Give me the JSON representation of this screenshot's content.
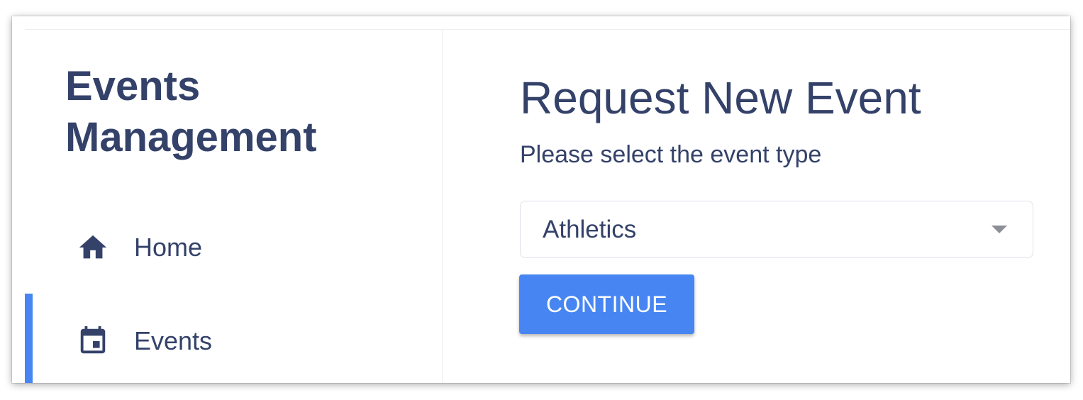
{
  "sidebar": {
    "app_title": "Events Management",
    "items": [
      {
        "label": "Home",
        "icon": "home-icon",
        "active": false
      },
      {
        "label": "Events",
        "icon": "calendar-icon",
        "active": true
      }
    ]
  },
  "main": {
    "title": "Request New Event",
    "prompt": "Please select the event type",
    "event_type_select": {
      "selected": "Athletics"
    },
    "continue_label": "CONTINUE"
  },
  "colors": {
    "text": "#34426a",
    "accent": "#4786f2",
    "border": "#dfe2ea"
  }
}
